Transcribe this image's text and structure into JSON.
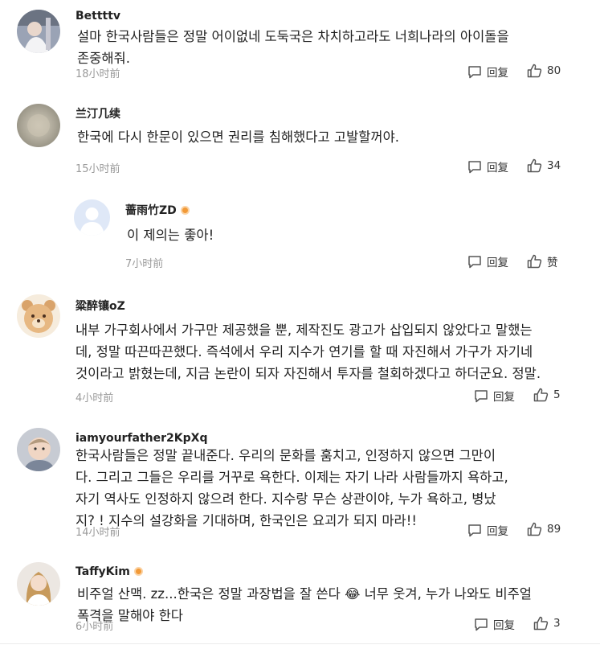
{
  "comments": [
    {
      "username": "Bettttv",
      "text": "설마 한국사람들은 정말 어이없네 도둑국은 차치하고라도 너희나라의 아이돌을\n존중해줘.",
      "time": "18小时前",
      "reply_label": "回复",
      "like_count": "80"
    },
    {
      "username": "兰汀几续",
      "text": " 한국에 다시 한문이 있으면 권리를 침해했다고 고발할꺼야.",
      "time": "15小时前",
      "reply_label": "回复",
      "like_count": "34"
    },
    {
      "username": "蔷雨竹ZD",
      "text": " 이 제의는 좋아!",
      "time": "7小时前",
      "reply_label": "回复",
      "like_count": "赞"
    },
    {
      "username": "粱醉镶oZ",
      "text": "내부 가구회사에서 가구만 제공했을 뿐, 제작진도 광고가 삽입되지 않았다고 말했는\n데, 정말 따끈따끈했다. 즉석에서 우리 지수가 연기를 할 때 자진해서 가구가 자기네\n것이라고 밝혔는데, 지금 논란이 되자 자진해서 투자를 철회하겠다고 하더군요. 정말.",
      "time": "4小时前",
      "reply_label": "回复",
      "like_count": "5"
    },
    {
      "username": "iamyourfather2KpXq",
      "text": "한국사람들은 정말 끝내준다. 우리의 문화를 훔치고, 인정하지 않으면 그만이\n다. 그리고 그들은 우리를 거꾸로 욕한다. 이제는 자기 나라 사람들까지 욕하고,\n자기 역사도 인정하지 않으려 한다. 지수랑 무슨 상관이야, 누가 욕하고, 병났\n지? ! 지수의 설강화을 기대하며, 한국인은 요괴가 되지 마라!!",
      "time": "14小时前",
      "reply_label": "回复",
      "like_count": "89"
    },
    {
      "username": "TaffyKim",
      "text": " 비주얼 산맥. zz...한국은 정말 과장법을 잘 쓴다 😂 너무 웃겨, 누가 나와도 비주얼\n 폭격을 말해야 한다",
      "time": "6小时前",
      "reply_label": "回复",
      "like_count": "3"
    }
  ],
  "colors": {
    "text": "#222222",
    "meta": "#9a9a9a",
    "badge": "#f29a38"
  },
  "icons": {
    "reply": "comment-bubble-icon",
    "like": "thumbs-up-icon",
    "badge": "verified-badge-icon"
  }
}
